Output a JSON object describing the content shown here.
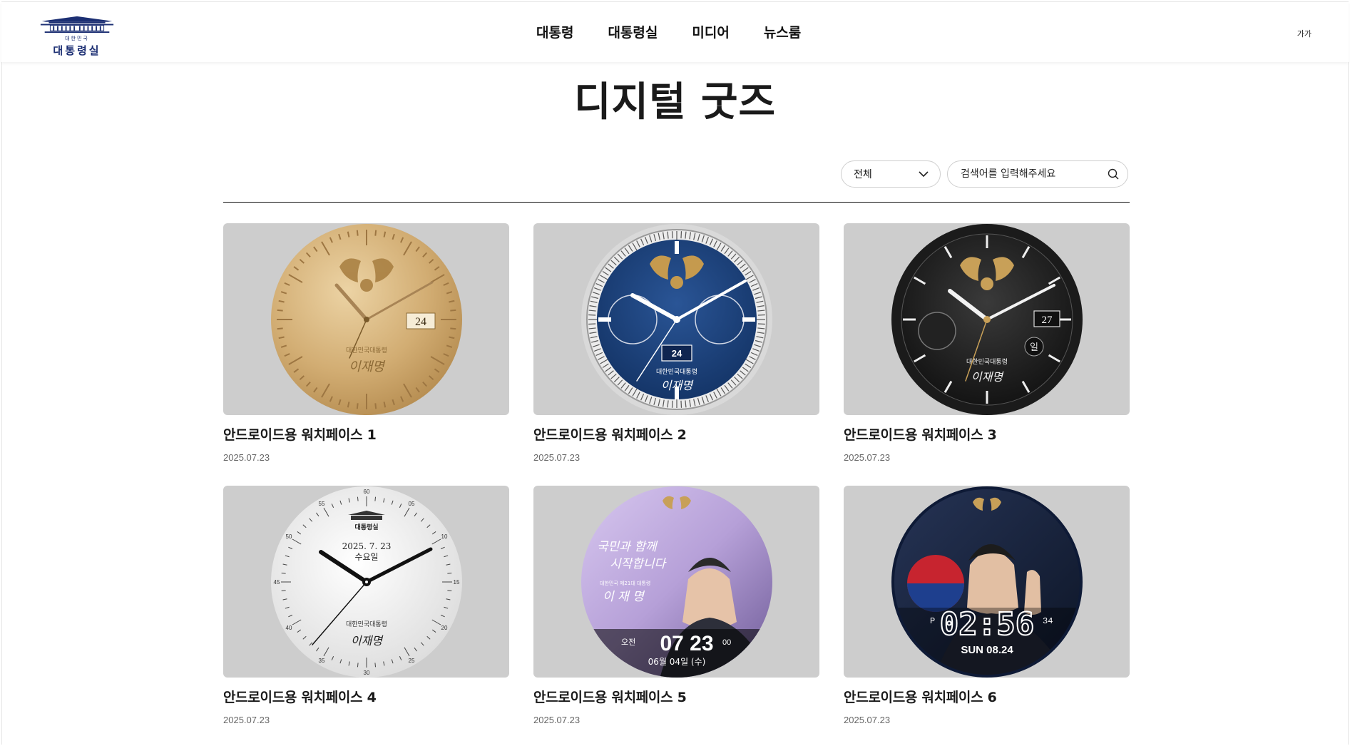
{
  "header": {
    "logo": {
      "small": "대한민국",
      "big": "대통령실"
    },
    "nav": [
      "대통령",
      "대통령실",
      "미디어",
      "뉴스룸"
    ],
    "font_size_label": "가가"
  },
  "page": {
    "title": "디지털 굿즈"
  },
  "filters": {
    "category_selected": "전체",
    "search_placeholder": "검색어를 입력해주세요"
  },
  "items": [
    {
      "title": "안드로이드용 워치페이스 1",
      "date": "2025.07.23",
      "face": {
        "style": "gold",
        "date_num": "24",
        "sig_small": "대한민국대통령",
        "sig": "이재명"
      }
    },
    {
      "title": "안드로이드용 워치페이스 2",
      "date": "2025.07.23",
      "face": {
        "style": "blue",
        "date_num": "24",
        "sig_small": "대한민국대통령",
        "sig": "이재명"
      }
    },
    {
      "title": "안드로이드용 워치페이스 3",
      "date": "2025.07.23",
      "face": {
        "style": "black",
        "date_num": "27",
        "day": "일",
        "sig_small": "대한민국대통령",
        "sig": "이재명"
      }
    },
    {
      "title": "안드로이드용 워치페이스 4",
      "date": "2025.07.23",
      "face": {
        "style": "white",
        "logo": "대통령실",
        "date_text": "2025. 7. 23",
        "weekday": "수요일",
        "sig_small": "대한민국대통령",
        "sig": "이재명",
        "ticks": [
          "60",
          "05",
          "10",
          "15",
          "20",
          "25",
          "30",
          "35",
          "40",
          "45",
          "50",
          "55"
        ]
      }
    },
    {
      "title": "안드로이드용 워치페이스 5",
      "date": "2025.07.23",
      "face": {
        "style": "photo",
        "slogan1": "국민과 함께",
        "slogan2": "시작합니다",
        "sig_small": "대한민국 제21대 대통령",
        "sig": "이 재 명",
        "ampm": "오전",
        "time": "07 23",
        "sec": "00",
        "date_text": "06월 04일 (수)"
      }
    },
    {
      "title": "안드로이드용 워치페이스 6",
      "date": "2025.07.23",
      "face": {
        "style": "digital",
        "ampm": "P",
        "time": "02:56",
        "sec": "34",
        "date_text": "SUN 08.24"
      }
    }
  ],
  "colors": {
    "accent_navy": "#1c2f73",
    "thumb_bg": "#cdcdcd",
    "gold": "#c8a058",
    "blue_dial": "#1a3f78"
  }
}
